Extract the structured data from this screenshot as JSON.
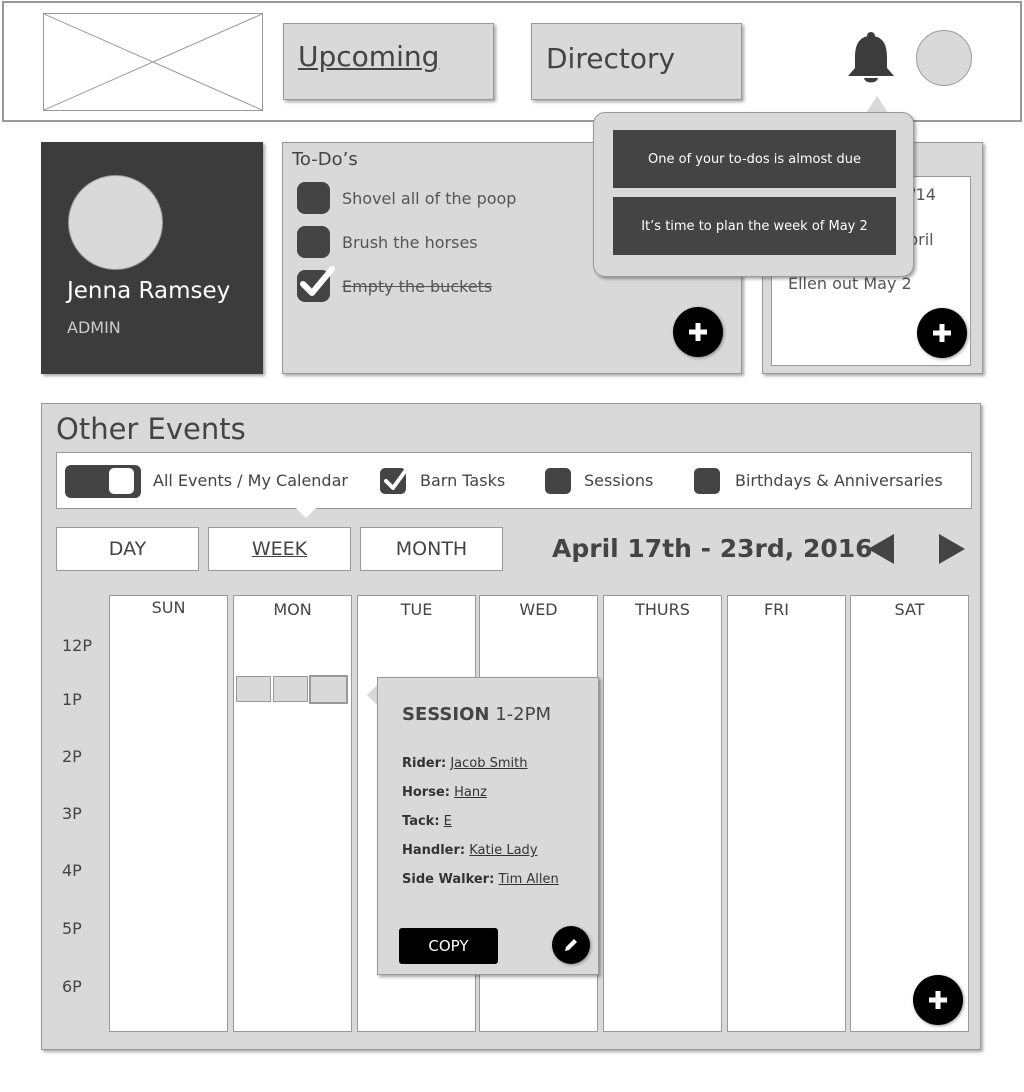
{
  "header": {
    "nav_upcoming": "Upcoming",
    "nav_directory": "Directory"
  },
  "profile": {
    "name": "Jenna Ramsey",
    "role": "ADMIN"
  },
  "todo": {
    "title": "To-Do’s",
    "items": [
      {
        "label": "Shovel all of the poop",
        "done": false
      },
      {
        "label": "Brush the horses",
        "done": false
      },
      {
        "label": "Empty the buckets",
        "done": true
      }
    ]
  },
  "notes": {
    "lines": [
      "3/14",
      "pril",
      "Ellen out May 2"
    ]
  },
  "notifications": [
    "One of your to-dos is almost due",
    "It’s time to plan the week of May 2"
  ],
  "events": {
    "title": "Other Events",
    "filters": {
      "toggle_label": "All Events / My Calendar",
      "barn_tasks": "Barn Tasks",
      "sessions": "Sessions",
      "birthdays": "Birthdays & Anniversaries"
    },
    "views": [
      "DAY",
      "WEEK",
      "MONTH"
    ],
    "active_view": "WEEK",
    "date_range": "April 17th - 23rd, 2016",
    "days": [
      "SUN",
      "MON",
      "TUE",
      "WED",
      "THURS",
      "FRI",
      "SAT"
    ],
    "times": [
      "12P",
      "1P",
      "2P",
      "3P",
      "4P",
      "5P",
      "6P"
    ]
  },
  "session": {
    "type": "SESSION",
    "time": "1-2PM",
    "rows": [
      {
        "label": "Rider:",
        "value": "Jacob Smith"
      },
      {
        "label": "Horse:",
        "value": "Hanz"
      },
      {
        "label": "Tack:",
        "value": "E"
      },
      {
        "label": "Handler:",
        "value": "Katie Lady"
      },
      {
        "label": "Side Walker:",
        "value": "Tim Allen"
      }
    ],
    "copy_label": "COPY"
  },
  "colors": {
    "panel": "#d9d9d9",
    "dark": "#3c3c3c",
    "accent": "#000000"
  }
}
